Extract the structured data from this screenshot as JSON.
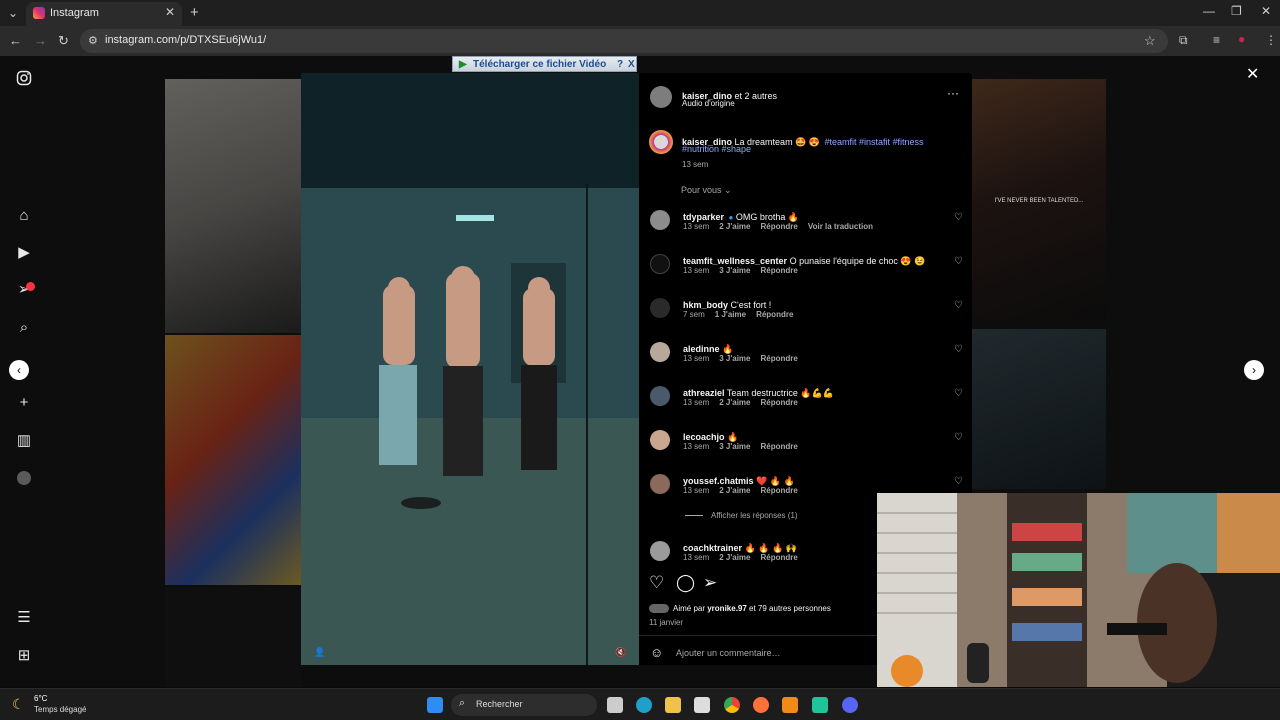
{
  "browser": {
    "tab_title": "Instagram",
    "url": "instagram.com/p/DTXSEu6jWu1/"
  },
  "download_banner": {
    "label": "Télécharger ce fichier Vidéo",
    "help": "?",
    "close": "X"
  },
  "post": {
    "header_user": "kaiser_dino",
    "header_rest": " et 2 autres",
    "audio": "Audio d'origine",
    "caption_user": "kaiser_dino",
    "caption_text": " La dreamteam 🤩 😍",
    "hashtags_line1": "#teamfit #instafit #fitness",
    "hashtags_line2": "#nutrition #shape",
    "caption_time": "13 sem",
    "sort_label": "Pour vous",
    "view_replies": "Afficher les réponses (1)",
    "likes_text_prefix": "Aimé par ",
    "likes_user": "yronike.97",
    "likes_text_suffix": " et 79 autres personnes",
    "date": "11 janvier",
    "add_comment_placeholder": "Ajouter un commentaire…"
  },
  "comments": [
    {
      "user": "tdyparker",
      "text": " OMG brotha 🔥",
      "time": "13 sem",
      "likes": "2 J'aime",
      "reply": "Répondre",
      "extra": "Voir la traduction",
      "verified": true
    },
    {
      "user": "teamfit_wellness_center",
      "text": " O punaise l'équipe de choc 😍 😉",
      "time": "13 sem",
      "likes": "3 J'aime",
      "reply": "Répondre"
    },
    {
      "user": "hkm_body",
      "text": " C'est fort !",
      "time": "7 sem",
      "likes": "1 J'aime",
      "reply": "Répondre"
    },
    {
      "user": "aledinne",
      "text": " 🔥",
      "time": "13 sem",
      "likes": "3 J'aime",
      "reply": "Répondre"
    },
    {
      "user": "athreaziel",
      "text": " Team destructrice 🔥💪💪",
      "time": "13 sem",
      "likes": "2 J'aime",
      "reply": "Répondre"
    },
    {
      "user": "lecoachjo",
      "text": " 🔥",
      "time": "13 sem",
      "likes": "3 J'aime",
      "reply": "Répondre"
    },
    {
      "user": "youssef.chatmis",
      "text": " ❤️ 🔥 🔥",
      "time": "13 sem",
      "likes": "2 J'aime",
      "reply": "Répondre"
    },
    {
      "user": "coachktrainer",
      "text": " 🔥 🔥 🔥 🙌",
      "time": "13 sem",
      "likes": "2 J'aime",
      "reply": "Répondre"
    }
  ],
  "background_tile_text": "I'VE NEVER BEEN TALENTED...",
  "weather": {
    "temp": "6°C",
    "desc": "Temps dégagé"
  },
  "taskbar": {
    "search_label": "Rechercher"
  },
  "colors": {
    "hashtag": "#8ea8ff",
    "accent_red": "#ff3040"
  }
}
